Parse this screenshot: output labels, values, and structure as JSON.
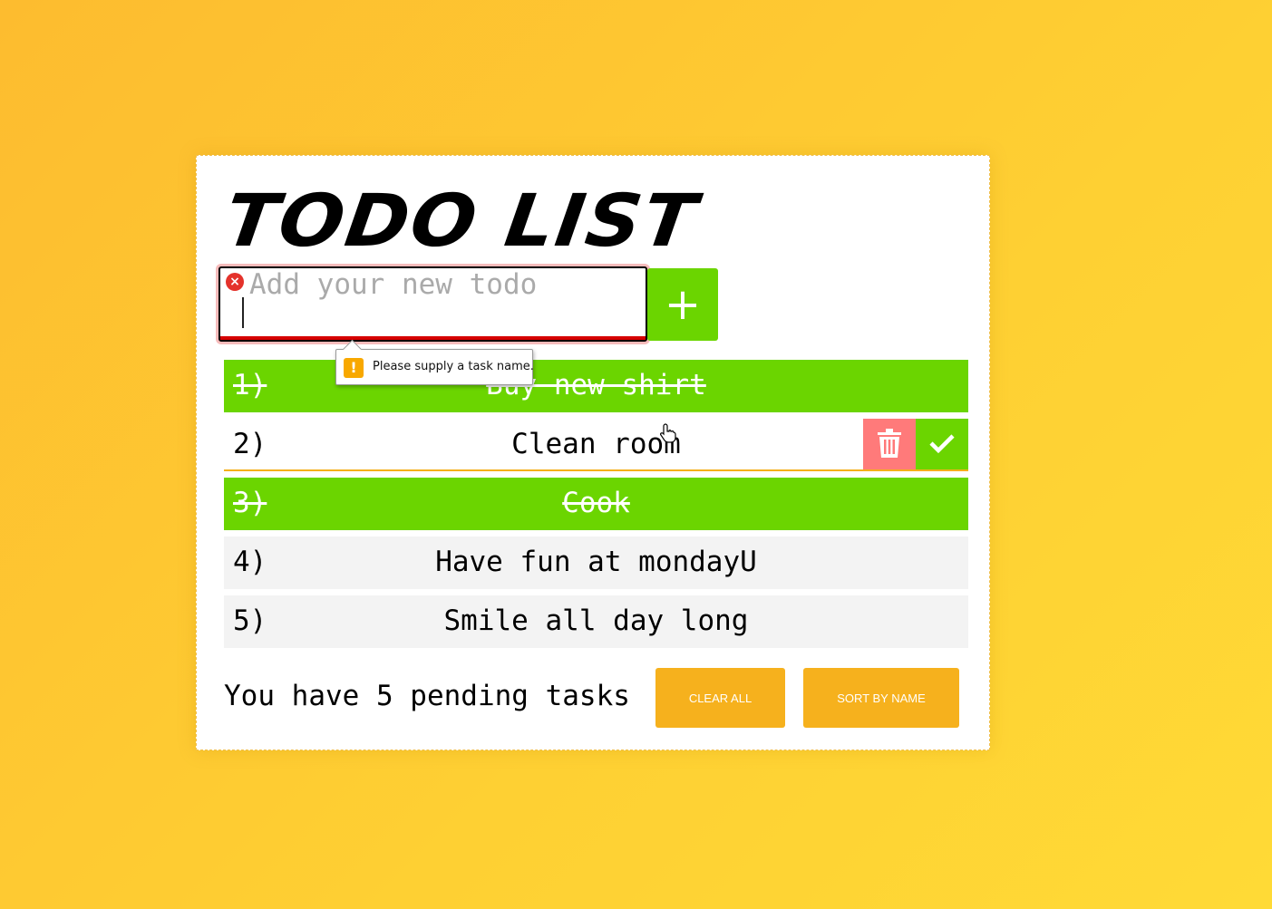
{
  "title": "TODO LIST",
  "input": {
    "placeholder": "Add your new todo",
    "value": ""
  },
  "add_button_label": "+",
  "validation": {
    "message": "Please supply a task name."
  },
  "todos": [
    {
      "num": "1)",
      "text": "Buy new shirt",
      "done": true
    },
    {
      "num": "2)",
      "text": "Clean room",
      "done": false
    },
    {
      "num": "3)",
      "text": "Cook",
      "done": true
    },
    {
      "num": "4)",
      "text": "Have fun at mondayU",
      "done": false
    },
    {
      "num": "5)",
      "text": "Smile all day long",
      "done": false
    }
  ],
  "footer": {
    "pending_text": "You have 5 pending tasks",
    "clear_label": "CLEAR ALL",
    "sort_label": "SORT BY NAME"
  },
  "colors": {
    "accent_green": "#6bd500",
    "delete_red": "#ff7a7a",
    "button_yellow": "#f6b11d",
    "error_red": "#d60000"
  },
  "icons": {
    "delete": "trash-icon",
    "complete": "check-icon",
    "add": "plus-icon",
    "error": "error-icon",
    "warning": "warning-icon"
  }
}
